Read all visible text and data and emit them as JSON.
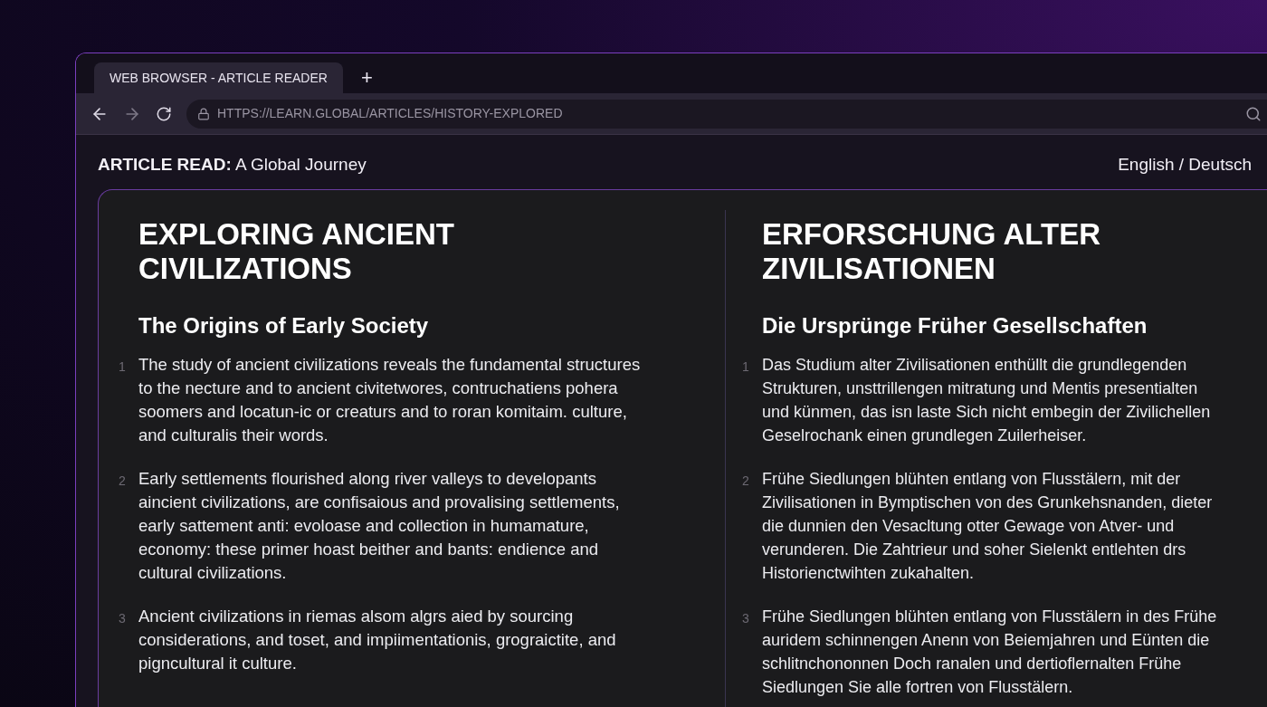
{
  "tabs": [
    {
      "title": "WEB BROWSER - ARTICLE READER",
      "selected": true
    }
  ],
  "new_tab": "+",
  "address_bar": {
    "url": "HTTPS://LEARN.GLOBAL/ARTICLES/HISTORY-EXPLORED"
  },
  "header": {
    "title": "**ARTICLE READ:** A Global Journey",
    "languages": "English / Deutsch"
  },
  "columns": [
    {
      "title_lines": [
        "EXPLORING ANCIENT",
        "CIVILIZATIONS"
      ],
      "subtitle": "The Origins of Early Society",
      "paragraphs": [
        {
          "number": "1",
          "lines": [
            "The study of ancient civilizations reveals the fundamental structures",
            "to the necture and to ancient civitetwores, contruchatiens pohera",
            "soomers and locatun-ic or creaturs and to roran komitaim. culture,",
            "and culturalis their words."
          ]
        },
        {
          "number": "2",
          "lines": [
            "Early settlements flourished along river valleys to developants",
            "aincient civilizations, are confisaious and provalising settlements,",
            "early sattement anti: evoloase and collection in humamature,",
            "economy: these primer hoast beither and bants: endience and",
            "cultural civilizations."
          ]
        },
        {
          "number": "3",
          "lines": [
            "Ancient civilizations in riemas alsom algrs aied by sourcing",
            "considerations, and toset, and impiimentationis, grograictite, and",
            "pigncultural it culture."
          ]
        }
      ]
    },
    {
      "title_lines": [
        "ERFORSCHUNG ALTER",
        "ZIVILISATIONEN"
      ],
      "subtitle": "Die Ursprünge Früher Gesellschaften",
      "paragraphs": [
        {
          "number": "1",
          "lines": [
            "Das Studium alter Zivilisationen enthüllt die grundlegenden",
            "Strukturen, unsttrillengen mitratung und Mentis presentialten",
            "und künmen, das isn laste Sich nicht embegin der Zivilichellen",
            "Geselrochank einen grundlegen Zuilerheiser."
          ]
        },
        {
          "number": "2",
          "lines": [
            "Frühe Siedlungen blühten entlang von Flusstälern, mit der",
            "Zivilisationen in Bymptischen von des Grunkehsnanden, dieter",
            "die dunnien den Vesacltung otter Gewage von Atver- und",
            "verunderen. Die Zahtrieur und soher Sielenkt entlehten drs",
            "Historienctwihten zukahalten."
          ]
        },
        {
          "number": "3",
          "lines": [
            "Frühe Siedlungen blühten entlang von Flusstälern in des Frühe",
            "auridem schinnengen Anenn von Beiemjahren und Eünten die",
            "schlitnchononnen Doch ranalen und dertioflernalten Frühe",
            "Siedlungen Sie alle fortren von Flusstälern."
          ]
        }
      ]
    }
  ]
}
